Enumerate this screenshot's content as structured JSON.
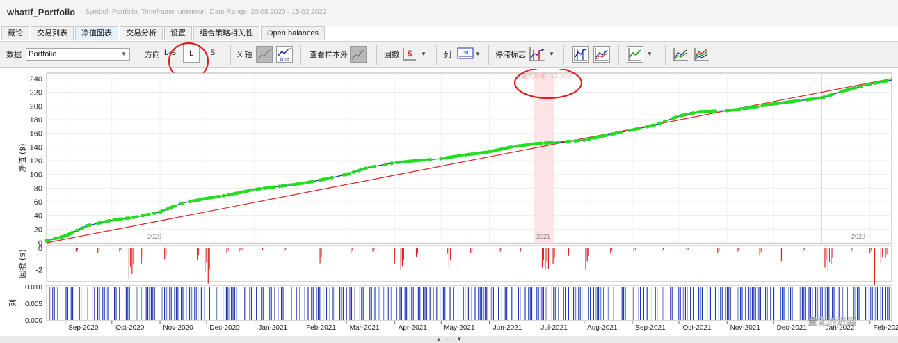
{
  "window": {
    "title": "whatIf_Portfolio",
    "subtitle": "Symbol: Portfolio, Timeframe: unknown, Date Range: 20.08.2020 - 15.02.2022"
  },
  "tabs": [
    {
      "label": "概论",
      "active": false
    },
    {
      "label": "交易列表",
      "active": false
    },
    {
      "label": "净值图表",
      "active": true
    },
    {
      "label": "交易分析",
      "active": false
    },
    {
      "label": "设置",
      "active": false
    },
    {
      "label": "组合策略相关性",
      "active": false
    },
    {
      "label": "Open balances",
      "active": false
    }
  ],
  "toolbar": {
    "data_label": "数据",
    "data_value": "Portfolio",
    "direction_label": "方向",
    "direction_ls": "L-S",
    "direction_l": "L",
    "direction_s": "S",
    "xaxis_label": "X 轴",
    "out_of_sample_label": "查看样本外",
    "drawdown_label": "回撤",
    "column_label": "列",
    "stagnation_label": "停滞标志",
    "icon_time_text": "time",
    "icon_on_text": "on",
    "icon_dollar_text": "$"
  },
  "chart_data": [
    {
      "type": "line",
      "title": "",
      "ylabel": "净值 ($)",
      "ylim": [
        0,
        240
      ],
      "yticks": [
        0,
        20,
        40,
        60,
        80,
        100,
        120,
        140,
        160,
        180,
        200,
        220,
        240
      ],
      "year_labels": [
        "2020",
        "2021",
        "2022"
      ],
      "stagnation_note": "最大停滞: 12 天以",
      "series": [
        {
          "name": "",
          "color": "#1a2fb0",
          "x": [
            "2020-08-20",
            "2020-09-01",
            "2020-09-15",
            "2020-10-01",
            "2020-10-15",
            "2020-11-01",
            "2020-11-15",
            "2020-12-01",
            "2020-12-15",
            "2021-01-01",
            "2021-01-15",
            "2021-02-01",
            "2021-02-15",
            "2021-03-01",
            "2021-03-15",
            "2021-04-01",
            "2021-04-15",
            "2021-05-01",
            "2021-05-15",
            "2021-06-01",
            "2021-06-15",
            "2021-07-01",
            "2021-07-15",
            "2021-08-01",
            "2021-08-15",
            "2021-09-01",
            "2021-09-15",
            "2021-10-01",
            "2021-10-15",
            "2021-11-01",
            "2021-11-15",
            "2021-12-01",
            "2021-12-15",
            "2022-01-01",
            "2022-01-15",
            "2022-02-01",
            "2022-02-15"
          ],
          "values": [
            3,
            10,
            25,
            33,
            37,
            45,
            58,
            65,
            70,
            78,
            82,
            87,
            93,
            100,
            110,
            117,
            120,
            123,
            128,
            133,
            140,
            145,
            147,
            150,
            157,
            165,
            172,
            185,
            192,
            193,
            197,
            203,
            207,
            212,
            222,
            232,
            238
          ]
        },
        {
          "name": "",
          "color": "#e02020",
          "x": [
            "2020-08-20",
            "2022-02-15"
          ],
          "values": [
            0,
            240
          ]
        }
      ]
    },
    {
      "type": "bar",
      "ylabel": "回撤 ($)",
      "ylim": [
        -3,
        0
      ],
      "yticks": [
        0,
        -2
      ],
      "x": [
        "2020-09-08",
        "2020-09-22",
        "2020-10-06",
        "2020-10-12",
        "2020-10-14",
        "2020-10-20",
        "2020-11-04",
        "2020-11-25",
        "2020-11-30",
        "2020-12-02",
        "2020-12-14",
        "2020-12-22",
        "2020-12-23",
        "2021-01-06",
        "2021-01-20",
        "2021-02-12",
        "2021-03-04",
        "2021-03-18",
        "2021-04-01",
        "2021-04-05",
        "2021-04-06",
        "2021-04-15",
        "2021-05-05",
        "2021-05-06",
        "2021-05-20",
        "2021-06-08",
        "2021-06-21",
        "2021-07-05",
        "2021-07-07",
        "2021-07-09",
        "2021-07-12",
        "2021-07-22",
        "2021-08-02",
        "2021-08-03",
        "2021-08-18",
        "2021-09-02",
        "2021-09-20",
        "2021-10-06",
        "2021-10-26",
        "2021-11-08",
        "2021-11-22",
        "2021-12-06",
        "2021-12-20",
        "2022-01-03",
        "2022-01-05",
        "2022-01-07",
        "2022-01-20",
        "2022-02-01",
        "2022-02-04",
        "2022-02-08",
        "2022-02-11"
      ],
      "values": [
        -0.3,
        -0.4,
        -0.3,
        -2.9,
        -2.4,
        -1.5,
        -1.0,
        -1.1,
        -2.2,
        -3.3,
        -0.4,
        -0.3,
        -0.2,
        -0.2,
        -0.3,
        -1.4,
        -0.4,
        -0.3,
        -1.5,
        -2.0,
        -1.7,
        -0.8,
        -0.5,
        -1.8,
        -0.4,
        -0.3,
        -0.3,
        -1.8,
        -2.0,
        -1.9,
        -1.5,
        -0.7,
        -2.0,
        -1.2,
        -0.4,
        -0.3,
        -0.3,
        -0.2,
        -0.4,
        -0.3,
        -0.6,
        -1.2,
        -0.3,
        -1.8,
        -2.1,
        -1.5,
        -0.3,
        -0.4,
        -3.4,
        -1.4,
        -0.9
      ],
      "color": "#dd2222"
    },
    {
      "type": "bar",
      "ylabel": "列",
      "ylim": [
        0,
        0.01
      ],
      "yticks": [
        "0.010",
        "0.005",
        "0.000"
      ],
      "note": "daily trade bars (density strip)",
      "color": "#1a2fb0",
      "x_months": [
        "Sep-2020",
        "Oct-2020",
        "Nov-2020",
        "Dec-2020",
        "Jan-2021",
        "Feb-2021",
        "Mar-2021",
        "Apr-2021",
        "May-2021",
        "Jun-2021",
        "Jul-2021",
        "Aug-2021",
        "Sep-2021",
        "Oct-2021",
        "Nov-2021",
        "Dec-2021",
        "Jan-2022",
        "Feb-2022"
      ]
    }
  ],
  "colors": {
    "equity_markers": "#22dd22",
    "highlight_band": "#fde3e3",
    "annotation_circle": "#e02020"
  },
  "watermark": "量化的进展"
}
